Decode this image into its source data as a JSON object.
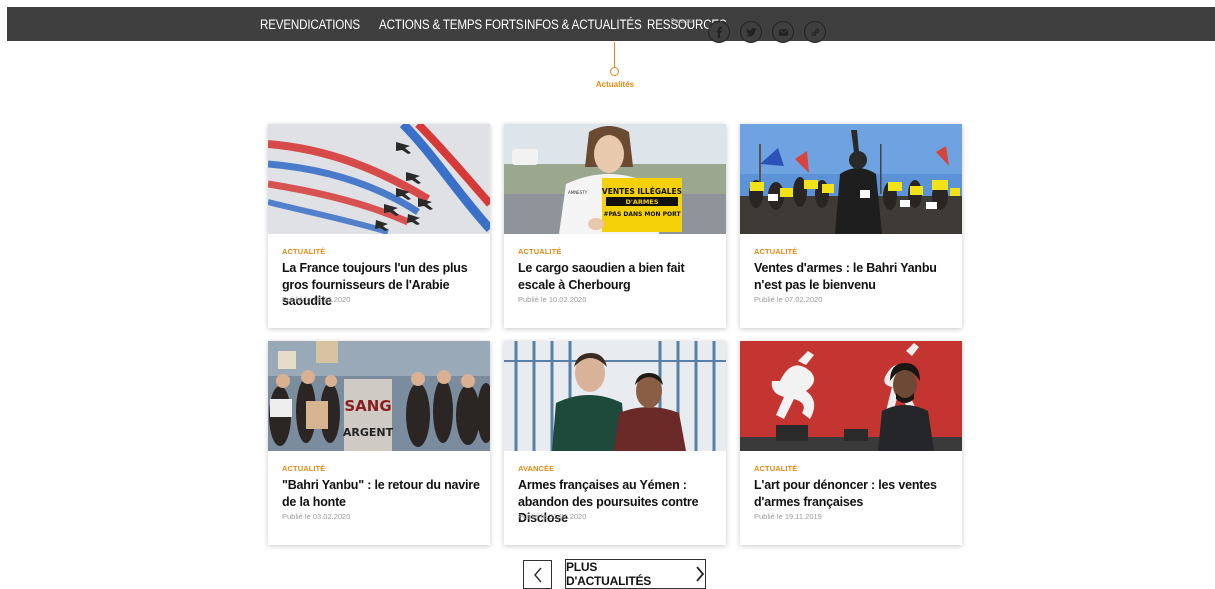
{
  "nav": {
    "items": [
      "REVENDICATIONS",
      "ACTIONS & TEMPS FORTS",
      "INFOS & ACTUALITÉS",
      "RESSOURCES"
    ],
    "share_label": "Partager",
    "socials": [
      "facebook-icon",
      "twitter-icon",
      "email-icon",
      "link-icon"
    ]
  },
  "section": {
    "label": "Actualités"
  },
  "colors": {
    "accent": "#e08a14",
    "topbar": "#3f3f3f"
  },
  "cards": [
    {
      "category": "ACTUALITÉ",
      "title": "La France toujours l'un des plus gros fournisseurs de l'Arabie saoudite",
      "date": "Publié le 12.03.2020"
    },
    {
      "category": "ACTUALITÉ",
      "title": "Le cargo saoudien a bien fait escale à Cherbourg",
      "date": "Publié le 10.02.2020",
      "sign_text": [
        "VENTES ILLÉGALES",
        "D'ARMES",
        "#PAS DANS MON PORT"
      ]
    },
    {
      "category": "ACTUALITÉ",
      "title": "Ventes d'armes : le Bahri Yanbu n'est pas le bienvenu",
      "date": "Publié le 07.02.2020"
    },
    {
      "category": "ACTUALITÉ",
      "title": "\"Bahri Yanbu\" : le retour du navire de la honte",
      "date": "Publié le 03.02.2020",
      "sign_text": [
        "SANG",
        "ARGENT"
      ]
    },
    {
      "category": "AVANCÉE",
      "title": "Armes françaises au Yémen : abandon des poursuites contre Disclose",
      "date": "Publié le 31.01.2020"
    },
    {
      "category": "ACTUALITÉ",
      "title": "L'art pour dénoncer : les ventes d'armes françaises",
      "date": "Publié le 19.11.2019"
    }
  ],
  "pagination": {
    "more_label": "PLUS D'ACTUALITÉS"
  }
}
